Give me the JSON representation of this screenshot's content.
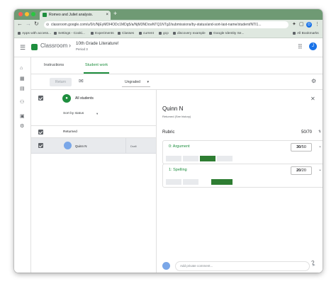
{
  "browser": {
    "tab_title": "Romeo and Juliet analysis.",
    "tab_close": "×",
    "new_tab": "+",
    "url": "classroom.google.com/u/0/c/NjEyMDI4ODc1MDg5/a/NjM3NDcwNTQ1NTg2/submissions/by-status/and-sort-last-name/student/NTI1...",
    "avatar_letter": "D",
    "bookmarks": [
      "Apps with access...",
      "Settings - Cooki...",
      "Experiments",
      "Classes",
      "current",
      "gcp",
      "discovery example",
      "Google Identity Se..."
    ],
    "all_bookmarks": "All Bookmarks"
  },
  "app": {
    "product": "Classroom",
    "class_name": "10th Grade Literature!",
    "period": "Period 3",
    "account_letter": "J"
  },
  "page_tabs": [
    "Instructions",
    "Student work"
  ],
  "actions": {
    "return_label": "Return",
    "grade_filter": "Ungraded"
  },
  "roster": {
    "all_students": "All students",
    "sort_label": "Sort by status",
    "section": "Returned",
    "students": [
      {
        "name": "Quinn N",
        "status": "Draft"
      }
    ]
  },
  "detail": {
    "student_name": "Quinn N",
    "status": "Returned (See history)",
    "rubric_label": "Rubric",
    "rubric_score": "50/70",
    "criteria": [
      {
        "title": "0: Argument",
        "score": "30",
        "max": "/50",
        "levels": 4,
        "selected": 2
      },
      {
        "title": "1: Spelling",
        "score": "20",
        "max": "/20",
        "levels": 4,
        "selected": 2
      }
    ],
    "comment_placeholder": "Add private comment..."
  },
  "colors": {
    "brand_green": "#1e8e3e",
    "level_selected": "#2e7d32"
  }
}
